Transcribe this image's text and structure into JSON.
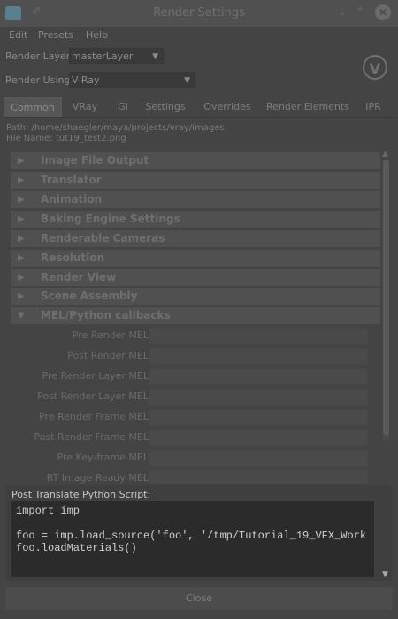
{
  "window": {
    "title": "Render Settings"
  },
  "menu": [
    "Edit",
    "Presets",
    "Help"
  ],
  "render_layer": {
    "label": "Render Layer",
    "value": "masterLayer"
  },
  "render_using": {
    "label": "Render Using",
    "value": "V-Ray"
  },
  "tabs": [
    "Common",
    "VRay",
    "GI",
    "Settings",
    "Overrides",
    "Render Elements",
    "IPR"
  ],
  "active_tab": "Common",
  "path_text": "Path: /home/shaegler/maya/projects/vray/images",
  "filename_text": "File Name: tut19_test2.png",
  "sections": [
    {
      "label": "Image File Output",
      "expanded": false
    },
    {
      "label": "Translator",
      "expanded": false
    },
    {
      "label": "Animation",
      "expanded": false
    },
    {
      "label": "Baking Engine Settings",
      "expanded": false
    },
    {
      "label": "Renderable Cameras",
      "expanded": false
    },
    {
      "label": "Resolution",
      "expanded": false
    },
    {
      "label": "Render View",
      "expanded": false
    },
    {
      "label": "Scene Assembly",
      "expanded": false
    },
    {
      "label": "MEL/Python callbacks",
      "expanded": true
    }
  ],
  "callback_fields": [
    "Pre Render MEL",
    "Post Render MEL",
    "Pre Render Layer MEL",
    "Post Render Layer MEL",
    "Pre Render Frame MEL",
    "Post Render Frame MEL",
    "Pre Key-frame MEL",
    "RT Image Ready MEL"
  ],
  "script": {
    "label": "Post Translate Python Script:",
    "code": "import imp\n\nfoo = imp.load_source('foo', '/tmp/Tutorial_19_VFX_Work\nfoo.loadMaterials()"
  },
  "close_button": "Close",
  "colors": {
    "background": "#444444",
    "code_bg": "#2b2b2b",
    "code_text": "#d0d0d0",
    "panel": "#3f3f3f"
  }
}
